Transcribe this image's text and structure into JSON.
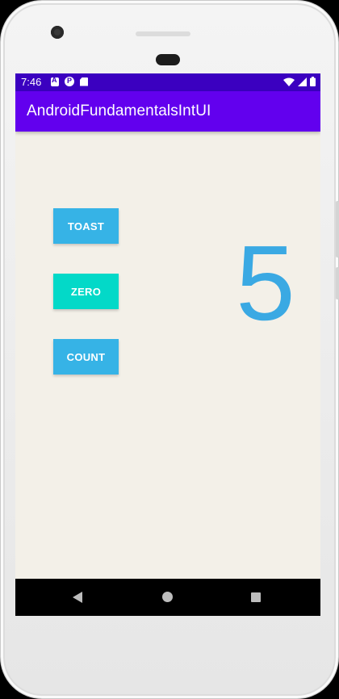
{
  "status_bar": {
    "time": "7:46",
    "left_icons": [
      "a-notification-icon",
      "p-notification-icon",
      "sd-card-icon"
    ],
    "right_icons": [
      "wifi-icon",
      "cell-signal-icon",
      "battery-icon"
    ]
  },
  "app_bar": {
    "title": "AndroidFundamentalsIntUI"
  },
  "buttons": {
    "toast_label": "TOAST",
    "zero_label": "ZERO",
    "count_label": "COUNT"
  },
  "counter": {
    "value": "5"
  },
  "nav_bar": {
    "icons": [
      "back-icon",
      "home-icon",
      "recents-icon"
    ]
  },
  "colors": {
    "status_bar": "#3b00c0",
    "app_bar": "#6200ee",
    "toast_button": "#36b3e6",
    "zero_button": "#03d9c8",
    "count_button": "#36b3e6",
    "counter_text": "#3aa9e3",
    "screen_background": "#f3f0e8"
  }
}
